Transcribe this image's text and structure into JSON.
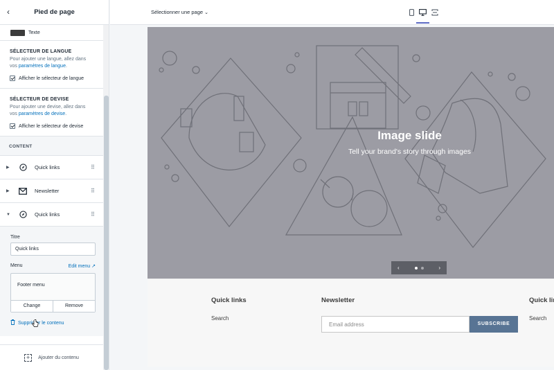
{
  "sidebar": {
    "title": "Pied de page",
    "text_swatch_label": "Texte",
    "language": {
      "heading": "SÉLECTEUR DE LANGUE",
      "desc_prefix": "Pour ajouter une langue, allez dans vos",
      "desc_link": "paramètres de langue",
      "desc_suffix": ".",
      "checkbox_label": "Afficher le sélecteur de langue"
    },
    "currency": {
      "heading": "SÉLECTEUR DE DEVISE",
      "desc_prefix": "Pour ajouter une devise, allez dans vos",
      "desc_link": "paramètres de devise",
      "desc_suffix": ".",
      "checkbox_label": "Afficher le sélecteur de devise"
    },
    "content_heading": "CONTENT",
    "blocks": [
      {
        "label": "Quick links",
        "icon": "compass-icon"
      },
      {
        "label": "Newsletter",
        "icon": "envelope-icon"
      },
      {
        "label": "Quick links",
        "icon": "compass-icon"
      }
    ],
    "edit": {
      "title_label": "Titre",
      "title_value": "Quick links",
      "menu_label": "Menu",
      "edit_menu": "Edit menu",
      "menu_name": "Footer menu",
      "change": "Change",
      "remove": "Remove",
      "delete_content": "Supprimer le contenu"
    },
    "add_content": "Ajouter du contenu"
  },
  "topbar": {
    "page_select": "Sélectionner une page"
  },
  "preview": {
    "hero_title": "Image slide",
    "hero_subtitle": "Tell your brand's story through images",
    "footer": {
      "col1_title": "Quick links",
      "col1_link": "Search",
      "col2_title": "Newsletter",
      "email_placeholder": "Email address",
      "subscribe": "SUBSCRIBE",
      "col3_title": "Quick links",
      "col3_link": "Search"
    }
  },
  "colors": {
    "accent": "#5c6ac4",
    "link": "#006fbb",
    "subscribe_bg": "#587494",
    "hero_bg": "#9c9ca4"
  }
}
